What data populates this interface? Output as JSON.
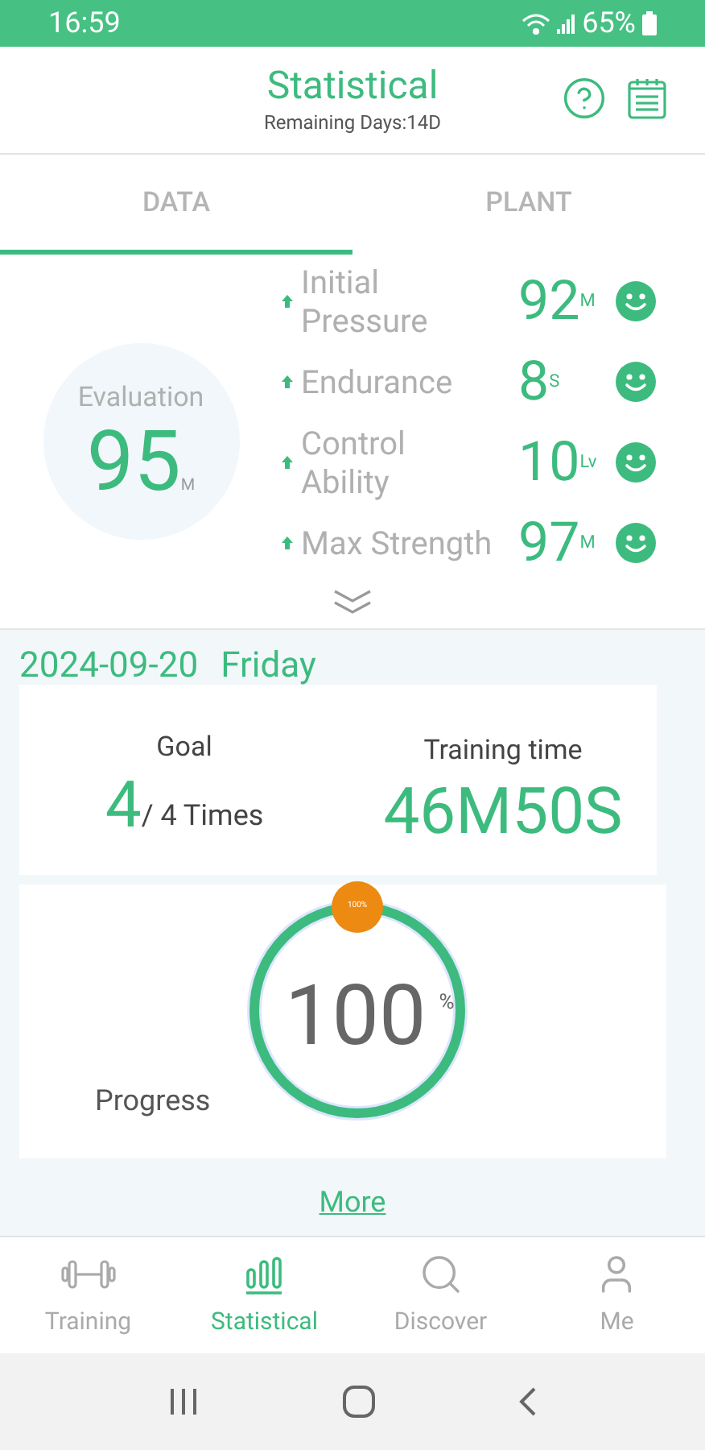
{
  "status_bar": {
    "time": "16:59",
    "battery": "65%"
  },
  "header": {
    "title": "Statistical",
    "subtitle": "Remaining Days:14D"
  },
  "tabs": [
    {
      "label": "DATA",
      "selected": true
    },
    {
      "label": "PLANT",
      "selected": false
    }
  ],
  "evaluation": {
    "label": "Evaluation",
    "value": "95",
    "unit": "M"
  },
  "metrics": [
    {
      "name": "Initial Pressure",
      "value": "92",
      "unit": "M"
    },
    {
      "name": "Endurance",
      "value": "8",
      "unit": "S"
    },
    {
      "name": "Control Ability",
      "value": "10",
      "unit": "Lv"
    },
    {
      "name": "Max Strength",
      "value": "97",
      "unit": "M"
    }
  ],
  "date": {
    "date": "2024-09-20",
    "weekday": "Friday"
  },
  "goal": {
    "label": "Goal",
    "done": "4",
    "total": "/ 4 Times"
  },
  "training_time": {
    "label": "Training time",
    "value": "46M50S"
  },
  "progress": {
    "label": "Progress",
    "value": "100",
    "unit": "%",
    "badge": "100%",
    "level": 1
  },
  "more_link": "More",
  "bottom_nav": [
    {
      "label": "Training",
      "selected": false
    },
    {
      "label": "Statistical",
      "selected": true
    },
    {
      "label": "Discover",
      "selected": false
    },
    {
      "label": "Me",
      "selected": false
    }
  ]
}
